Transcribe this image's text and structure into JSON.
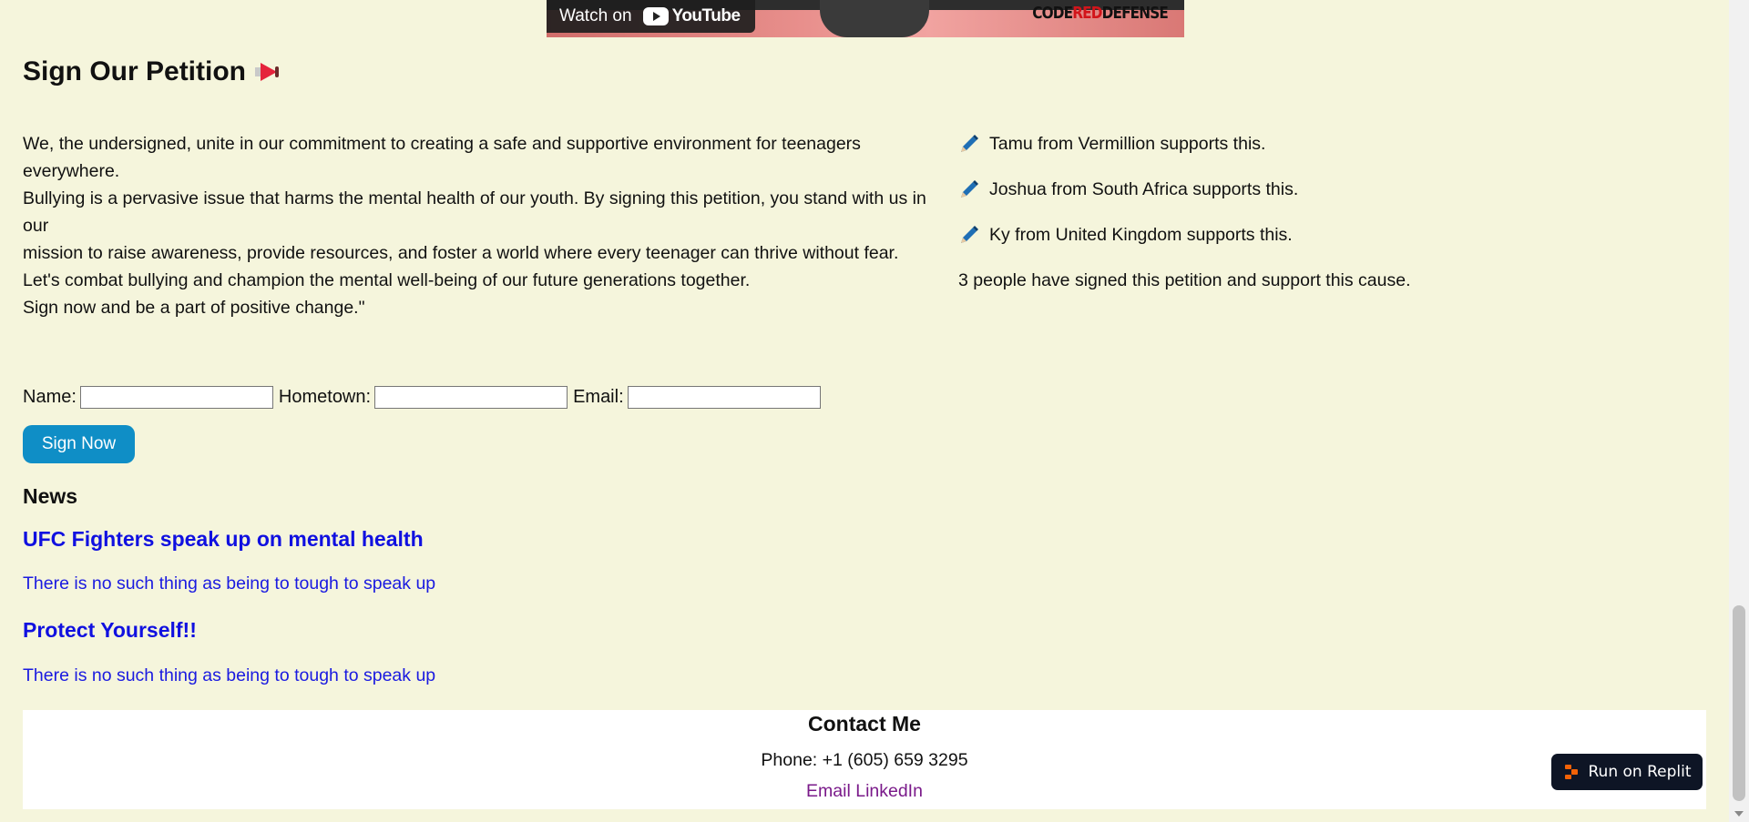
{
  "video": {
    "watch_on": "Watch on",
    "youtube": "YouTube",
    "brand": "CODEREDDEFENSE",
    "brand_prefix": "CODE",
    "brand_red": "RED",
    "brand_suffix": "DEFENSE"
  },
  "petition": {
    "title": "Sign Our Petition",
    "lines": [
      "We, the undersigned, unite in our commitment to creating a safe and supportive environment for teenagers everywhere.",
      "Bullying is a pervasive issue that harms the mental health of our youth. By signing this petition, you stand with us in our",
      "mission to raise awareness, provide resources, and foster a world where every teenager can thrive without fear.",
      "Let's combat bullying and champion the mental well-being of our future generations together.",
      "Sign now and be a part of positive change.\""
    ],
    "supporters": [
      "Tamu from Vermillion supports this.",
      "Joshua from South Africa supports this.",
      "Ky from United Kingdom supports this."
    ],
    "signed_count_text": "3 people have signed this petition and support this cause."
  },
  "form": {
    "name_label": "Name:",
    "hometown_label": "Hometown:",
    "email_label": "Email:",
    "name_value": "",
    "hometown_value": "",
    "email_value": "",
    "submit_label": "Sign Now"
  },
  "news": {
    "heading": "News",
    "items": [
      {
        "title": "UFC Fighters speak up on mental health",
        "subtitle": "There is no such thing as being to tough to speak up"
      },
      {
        "title": "Protect Yourself!!",
        "subtitle": "There is no such thing as being to tough to speak up"
      }
    ]
  },
  "contact": {
    "heading": "Contact Me",
    "phone": "Phone: +1 (605) 659 3295",
    "email_link": "Email",
    "linkedin_link": "LinkedIn"
  },
  "replit": {
    "label": "Run on Replit"
  },
  "colors": {
    "background": "#f5f5dc",
    "button": "#0f8ec6",
    "news_link": "#1010e0",
    "visited_link": "#7a1a8a",
    "replit_bg": "#0e1525"
  }
}
